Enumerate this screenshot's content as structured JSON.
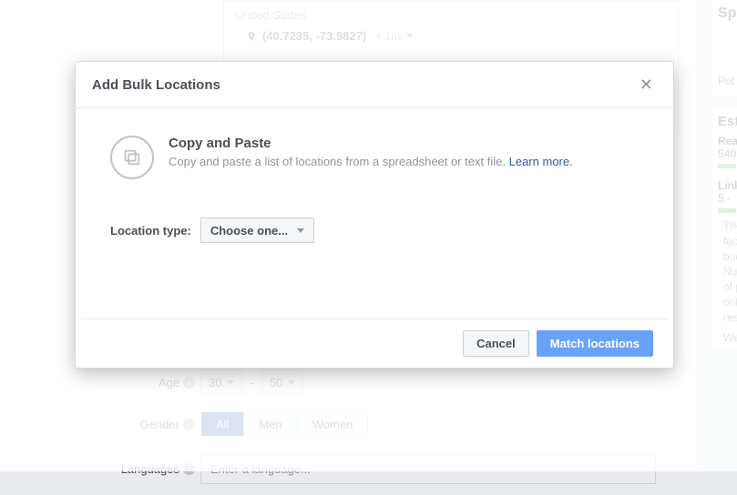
{
  "background": {
    "location_box": {
      "country": "United States",
      "coords": "(40.7235, -73.9827)",
      "radius": "+ 1mi"
    },
    "age": {
      "label": "Age",
      "from": "30",
      "dash": "-",
      "to": "50"
    },
    "gender": {
      "label": "Gender",
      "options": {
        "all": "All",
        "men": "Men",
        "women": "Women"
      }
    },
    "languages": {
      "label": "Languages",
      "placeholder": "Enter a language..."
    }
  },
  "sidebar": {
    "spec": "Spec",
    "pot": "Pot",
    "est_label": "Est",
    "reach_label": "Rea",
    "reach_value": "540",
    "clicks_label": "Link",
    "clicks_value": "5 -",
    "paragraph": [
      "The",
      "fact",
      "bud",
      "Nur",
      "of p",
      "only",
      "resu"
    ],
    "were": "Were"
  },
  "modal": {
    "title": "Add Bulk Locations",
    "copy_paste": {
      "heading": "Copy and Paste",
      "sub": "Copy and paste a list of locations from a spreadsheet or text file.",
      "learn_more": "Learn more."
    },
    "location_type": {
      "label": "Location type:",
      "placeholder": "Choose one..."
    },
    "buttons": {
      "cancel": "Cancel",
      "match": "Match locations"
    }
  }
}
